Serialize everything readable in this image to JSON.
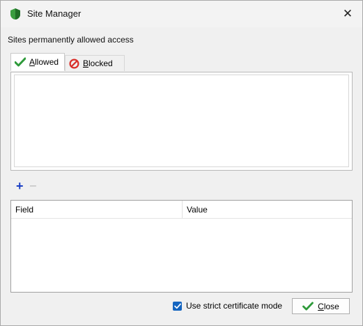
{
  "window": {
    "title": "Site Manager",
    "close_glyph": "✕"
  },
  "section_label": "Sites permanently allowed access",
  "tabs": [
    {
      "label_first": "A",
      "label_rest": "llowed",
      "icon": "green-check-icon",
      "active": true
    },
    {
      "label_first": "B",
      "label_rest": "locked",
      "icon": "blocked-icon",
      "active": false
    }
  ],
  "list_actions": {
    "add": "+",
    "remove": "–"
  },
  "table": {
    "columns": [
      "Field",
      "Value"
    ]
  },
  "strict_mode": {
    "label": "Use strict certificate mode",
    "checked": true
  },
  "close_button": {
    "label_first": "C",
    "label_rest": "lose"
  },
  "colors": {
    "accent_check": "#1565c0",
    "add_blue": "#1a3fc4",
    "check_green": "#2e9a3a",
    "blocked_red": "#d9302b"
  }
}
